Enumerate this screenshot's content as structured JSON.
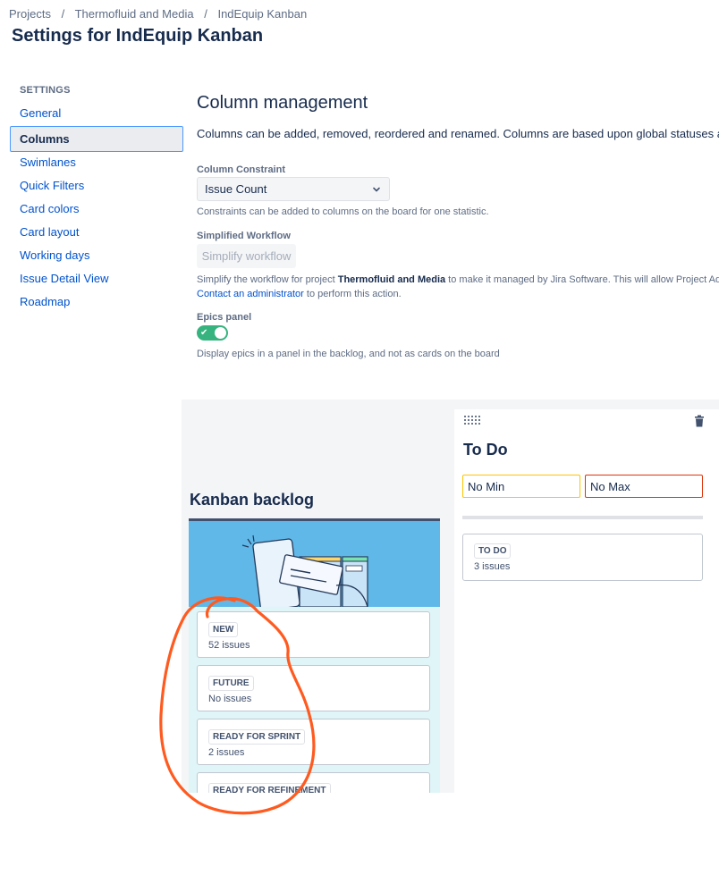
{
  "breadcrumb": {
    "items": [
      "Projects",
      "Thermofluid and Media",
      "IndEquip Kanban"
    ],
    "separator": "/"
  },
  "page_title": "Settings for IndEquip Kanban",
  "sidebar": {
    "heading": "SETTINGS",
    "items": [
      {
        "label": "General"
      },
      {
        "label": "Columns",
        "active": true
      },
      {
        "label": "Swimlanes"
      },
      {
        "label": "Quick Filters"
      },
      {
        "label": "Card colors"
      },
      {
        "label": "Card layout"
      },
      {
        "label": "Working days"
      },
      {
        "label": "Issue Detail View"
      },
      {
        "label": "Roadmap"
      }
    ]
  },
  "main": {
    "title": "Column management",
    "description": "Columns can be added, removed, reordered and renamed. Columns are based upon global statuses and can b",
    "column_constraint": {
      "label": "Column Constraint",
      "value": "Issue Count",
      "help": "Constraints can be added to columns on the board for one statistic."
    },
    "simplified_workflow": {
      "label": "Simplified Workflow",
      "button": "Simplify workflow",
      "help_prefix": "Simplify the workflow for project ",
      "help_project": "Thermofluid and Media",
      "help_suffix": " to make it managed by Jira Software. This will allow Project Administra",
      "contact_link": "Contact an administrator",
      "contact_suffix": " to perform this action."
    },
    "epics_panel": {
      "label": "Epics panel",
      "enabled": true,
      "help": "Display epics in a panel in the backlog, and not as cards on the board"
    }
  },
  "board": {
    "backlog": {
      "title": "Kanban backlog",
      "statuses": [
        {
          "name": "NEW",
          "count": "52 issues"
        },
        {
          "name": "FUTURE",
          "count": "No issues"
        },
        {
          "name": "READY FOR SPRINT",
          "count": "2 issues"
        },
        {
          "name": "READY FOR REFINEMENT",
          "count": ""
        }
      ]
    },
    "todo": {
      "title": "To Do",
      "min": "No Min",
      "max": "No Max",
      "statuses": [
        {
          "name": "TO DO",
          "count": "3 issues"
        }
      ]
    }
  },
  "colors": {
    "accent": "#0052cc",
    "toggle_on": "#36b37e",
    "min_border": "#ffc400",
    "max_border": "#de350b",
    "annotation": "#ff5a1f"
  },
  "icons": [
    "chevron-down-icon",
    "check-icon",
    "drag-handle-icon",
    "trash-icon"
  ]
}
